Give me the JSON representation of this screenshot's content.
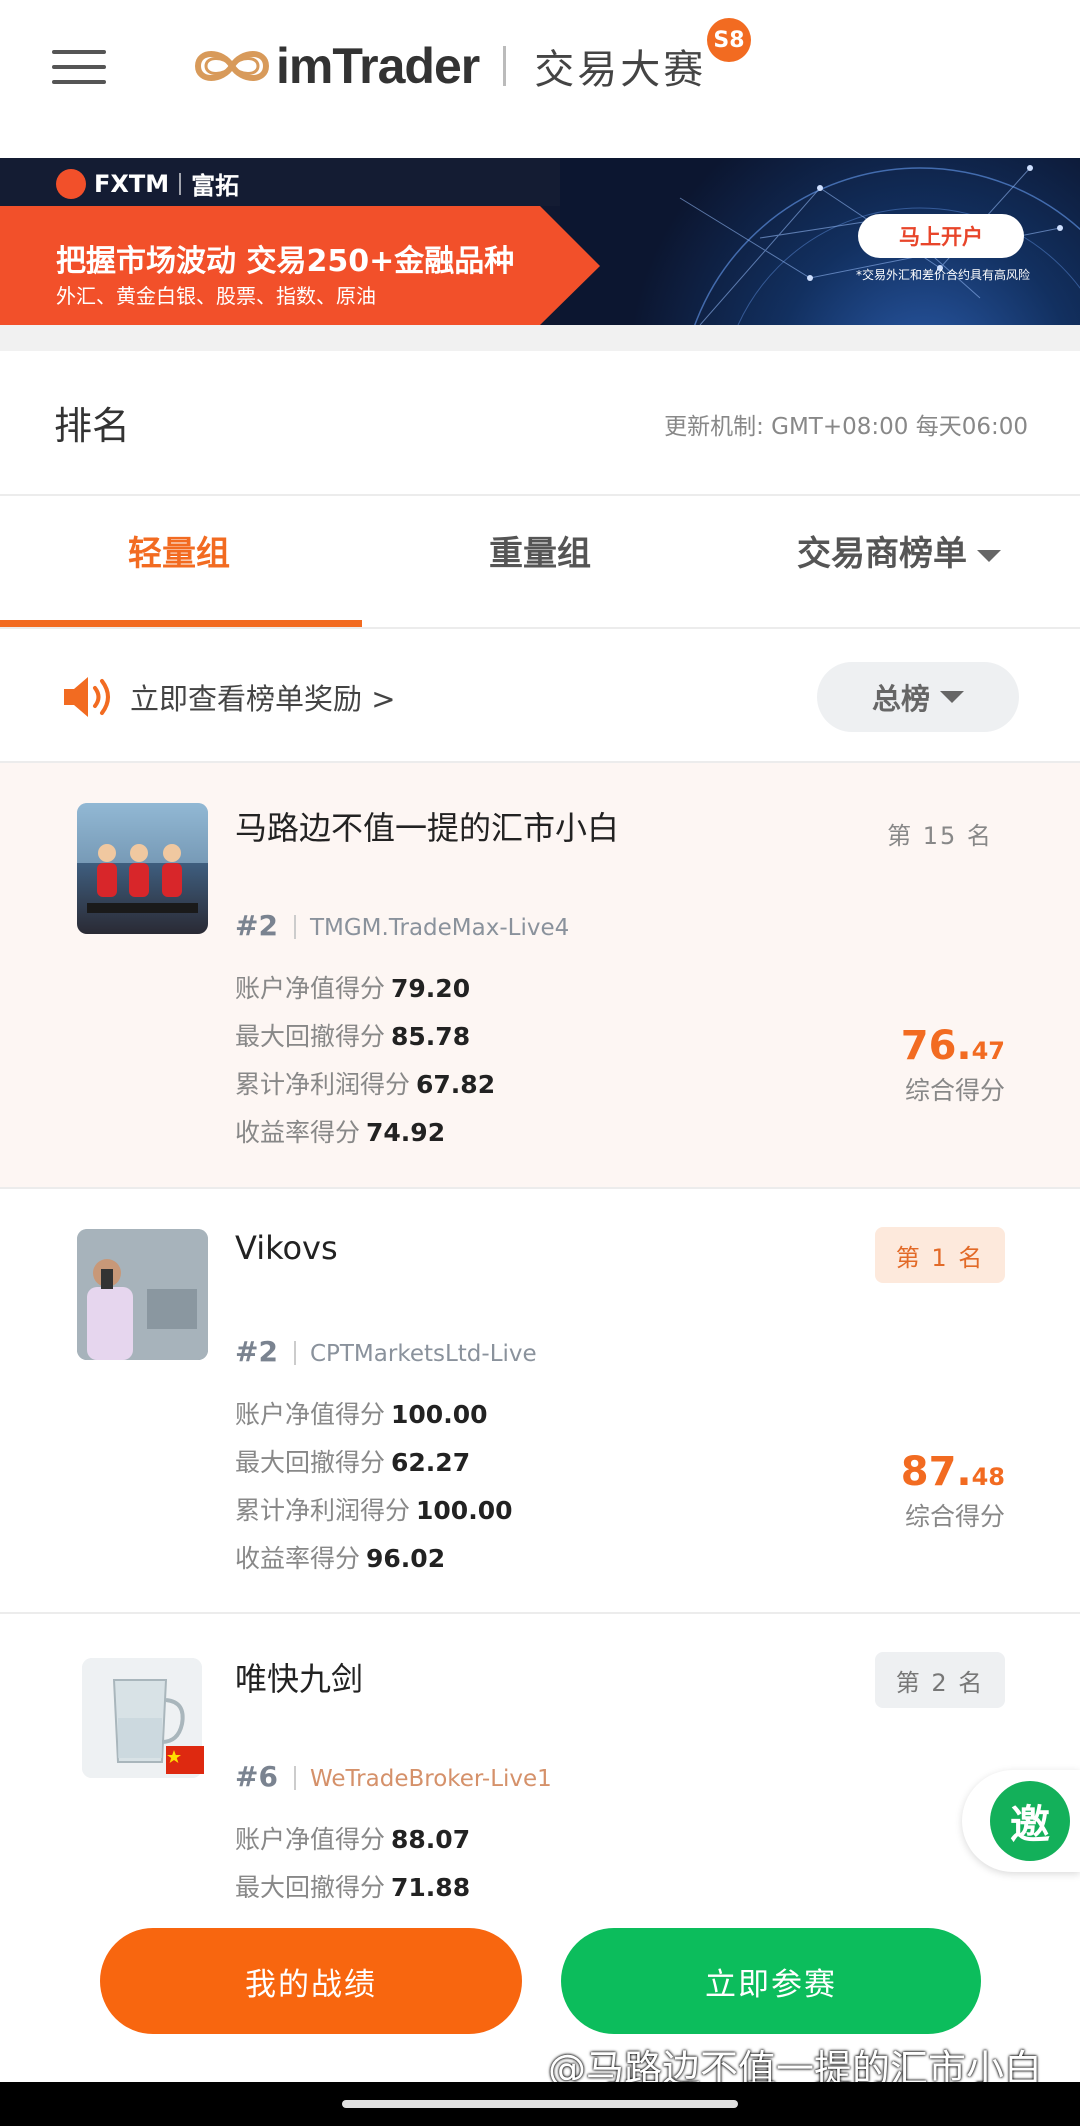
{
  "header": {
    "brand": "imTrader",
    "contest_name": "交易大赛",
    "season": "S8"
  },
  "banner": {
    "brand": "FXTM",
    "brand_cn": "富拓",
    "headline": "把握市场波动 交易250+金融品种",
    "subline": "外汇、黄金白银、股票、指数、原油",
    "cta": "马上开户",
    "risk_note": "*交易外汇和差价合约具有高风险"
  },
  "ranking": {
    "title": "排名",
    "update_rule": "更新机制: GMT+08:00 每天06:00"
  },
  "tabs": [
    {
      "label": "轻量组",
      "active": true
    },
    {
      "label": "重量组",
      "active": false
    },
    {
      "label": "交易商榜单",
      "active": false
    }
  ],
  "reward": {
    "link_text": "立即查看榜单奖励 >",
    "filter_label": "总榜"
  },
  "entries": [
    {
      "name": "马路边不值一提的汇市小白",
      "rank_label": "第 15 名",
      "team": "#2",
      "broker": "TMGM.TradeMax-Live4",
      "stats": [
        {
          "label": "账户净值得分",
          "value": "79.20"
        },
        {
          "label": "最大回撤得分",
          "value": "85.78"
        },
        {
          "label": "累计净利润得分",
          "value": "67.82"
        },
        {
          "label": "收益率得分",
          "value": "74.92"
        }
      ],
      "score_int": "76.",
      "score_dec": "47",
      "score_label": "综合得分"
    },
    {
      "name": "Vikovs",
      "rank_label": "第 1 名",
      "team": "#2",
      "broker": "CPTMarketsLtd-Live",
      "stats": [
        {
          "label": "账户净值得分",
          "value": "100.00"
        },
        {
          "label": "最大回撤得分",
          "value": "62.27"
        },
        {
          "label": "累计净利润得分",
          "value": "100.00"
        },
        {
          "label": "收益率得分",
          "value": "96.02"
        }
      ],
      "score_int": "87.",
      "score_dec": "48",
      "score_label": "综合得分"
    },
    {
      "name": "唯快九剑",
      "rank_label": "第 2 名",
      "team": "#6",
      "broker": "WeTradeBroker-Live1",
      "stats": [
        {
          "label": "账户净值得分",
          "value": "88.07"
        },
        {
          "label": "最大回撤得分",
          "value": "71.88"
        }
      ]
    }
  ],
  "invite_label": "邀",
  "buttons": {
    "my_record": "我的战绩",
    "join_now": "立即参赛"
  },
  "watermark": "@马路边不值一提的汇市小白",
  "colors": {
    "accent": "#f26b21",
    "green": "#0cbd5c",
    "banner_red": "#f2502a"
  }
}
